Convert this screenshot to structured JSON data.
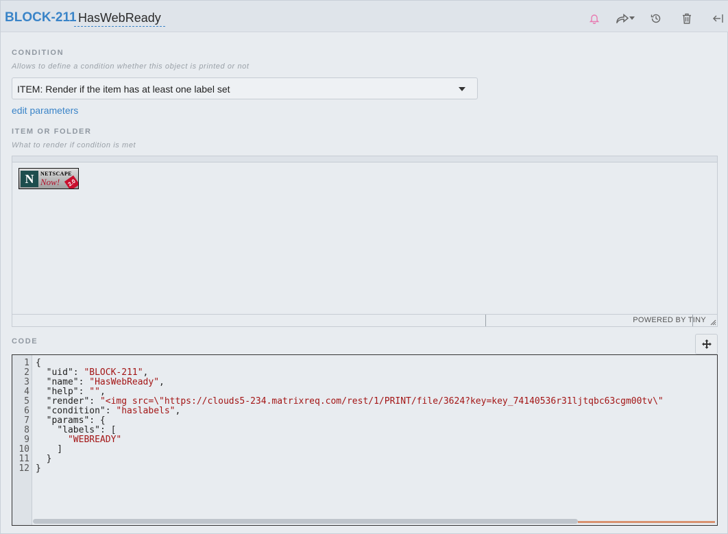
{
  "header": {
    "item_id": "BLOCK-211",
    "item_title": "HasWebReady",
    "icons": [
      "bell-icon",
      "share-icon",
      "chevron-down-icon",
      "history-icon",
      "trash-icon",
      "collapse-icon"
    ],
    "accent_color": "#3a84c8",
    "bell_color": "#e879b0"
  },
  "condition": {
    "label": "CONDITION",
    "help": "Allows to define a condition whether this object is printed or not",
    "selected": "ITEM: Render if the item has at least one label set",
    "edit_link": "edit parameters"
  },
  "item_or_folder": {
    "label": "ITEM OR FOLDER",
    "help": "What to render if condition is met",
    "image": {
      "top": "NETSCAPE",
      "main": "Now!",
      "version": "2.0",
      "initial": "N"
    },
    "status": "POWERED BY TINY"
  },
  "code": {
    "label": "CODE",
    "lines": [
      "1",
      "2",
      "3",
      "4",
      "5",
      "6",
      "7",
      "8",
      "9",
      "10",
      "11",
      "12"
    ],
    "tokens": {
      "open": "{",
      "uid_key": "\"uid\"",
      "uid_val": "\"BLOCK-211\"",
      "name_key": "\"name\"",
      "name_val": "\"HasWebReady\"",
      "help_key": "\"help\"",
      "help_val": "\"\"",
      "render_key": "\"render\"",
      "render_val": "\"<img src=\\\"https://clouds5-234.matrixreq.com/rest/1/PRINT/file/3624?key=key_74140536r31ljtqbc63cgm00tv\\\"",
      "condition_key": "\"condition\"",
      "condition_val": "\"haslabels\"",
      "params_key": "\"params\"",
      "labels_key": "\"labels\"",
      "labels_val": "\"WEBREADY\"",
      "close": "}"
    }
  }
}
